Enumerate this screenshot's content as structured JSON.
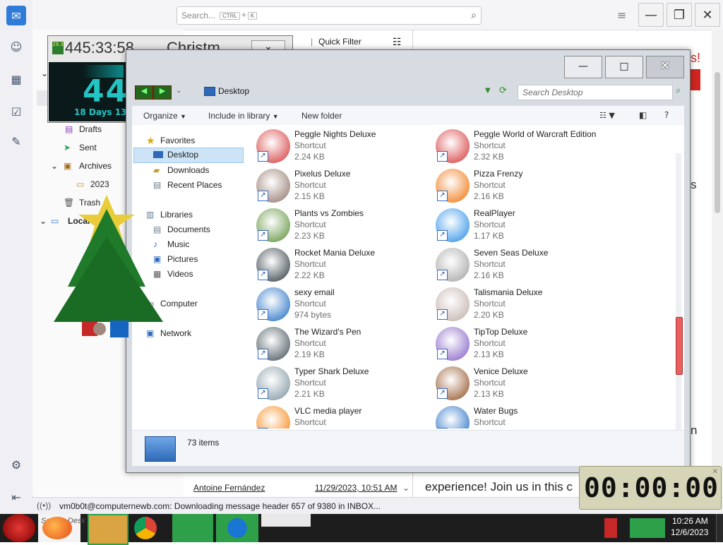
{
  "thunderbird": {
    "search_placeholder": "Search...",
    "search_key1": "CTRL",
    "search_plus": "+",
    "search_key2": "K",
    "quick_filter": "Quick Filter",
    "folders": {
      "drafts": "Drafts",
      "sent": "Sent",
      "archives": "Archives",
      "year_2023": "2023",
      "trash": "Trash",
      "local": "Local F"
    },
    "message_row": {
      "sender": "Antoine Fernández",
      "date": "11/29/2023, 10:51 AM"
    },
    "status_text": "vm0b0t@computernewb.com: Downloading message header 657 of 9380 in INBOX...",
    "preview_text": "experience! Join us in this c",
    "preview_fragment_s": "s",
    "preview_fragment_n": "n",
    "preview_bang": "s!"
  },
  "gadget": {
    "counter": "445:33:58",
    "title": "Christm",
    "big_number": "44",
    "days_text": "18 Days 13",
    "small_label": "29.3"
  },
  "explorer": {
    "location": "Desktop",
    "search_placeholder": "Search Desktop",
    "toolbar": {
      "organize": "Organize",
      "include": "Include in library",
      "new_folder": "New folder"
    },
    "nav": {
      "favorites": "Favorites",
      "desktop": "Desktop",
      "downloads": "Downloads",
      "recent": "Recent Places",
      "libraries": "Libraries",
      "documents": "Documents",
      "music": "Music",
      "pictures": "Pictures",
      "videos": "Videos",
      "computer": "Computer",
      "network": "Network"
    },
    "files": [
      {
        "name": "Peggle Nights Deluxe",
        "type": "Shortcut",
        "size": "2.24 KB",
        "icon": "peggle-icon"
      },
      {
        "name": "Peggle World of Warcraft Edition",
        "type": "Shortcut",
        "size": "2.32 KB",
        "icon": "peggle-icon"
      },
      {
        "name": "Pixelus Deluxe",
        "type": "Shortcut",
        "size": "2.15 KB",
        "icon": "pixelus-icon"
      },
      {
        "name": "Pizza Frenzy",
        "type": "Shortcut",
        "size": "2.16 KB",
        "icon": "pizza-icon"
      },
      {
        "name": "Plants vs Zombies",
        "type": "Shortcut",
        "size": "2.23 KB",
        "icon": "plant-icon"
      },
      {
        "name": "RealPlayer",
        "type": "Shortcut",
        "size": "1.17 KB",
        "icon": "realplayer-icon"
      },
      {
        "name": "Rocket Mania Deluxe",
        "type": "Shortcut",
        "size": "2.22 KB",
        "icon": "rocket-icon"
      },
      {
        "name": "Seven Seas Deluxe",
        "type": "Shortcut",
        "size": "2.16 KB",
        "icon": "skull-icon"
      },
      {
        "name": "sexy email",
        "type": "Shortcut",
        "size": "974 bytes",
        "icon": "thunderbird-icon"
      },
      {
        "name": "Talismania Deluxe",
        "type": "Shortcut",
        "size": "2.20 KB",
        "icon": "talisman-icon"
      },
      {
        "name": "The Wizard's Pen",
        "type": "Shortcut",
        "size": "2.19 KB",
        "icon": "wizard-icon"
      },
      {
        "name": "TipTop Deluxe",
        "type": "Shortcut",
        "size": "2.13 KB",
        "icon": "cocktail-icon"
      },
      {
        "name": "Typer Shark Deluxe",
        "type": "Shortcut",
        "size": "2.21 KB",
        "icon": "shark-icon"
      },
      {
        "name": "Venice Deluxe",
        "type": "Shortcut",
        "size": "2.13 KB",
        "icon": "gondola-icon"
      },
      {
        "name": "VLC media player",
        "type": "Shortcut",
        "size": "",
        "icon": "vlc-icon"
      },
      {
        "name": "Water Bugs",
        "type": "Shortcut",
        "size": "",
        "icon": "water-bugs-icon"
      }
    ],
    "item_count": "73 items"
  },
  "taskbar": {
    "search_text": "Search Desk",
    "time": "10:26 AM",
    "date": "12/6/2023"
  },
  "clock_widget": {
    "time": "00:00:00"
  },
  "colors": {
    "thunderbird_accent": "#2f7bd7",
    "gadget_digits": "#24c4c4",
    "explorer_frame": "#d7dbe2",
    "taskbar": "#1d1d1d"
  }
}
